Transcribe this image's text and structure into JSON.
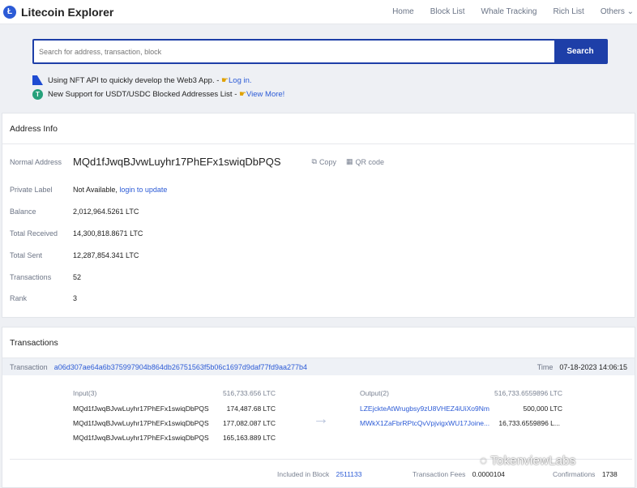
{
  "header": {
    "brand": "Litecoin Explorer",
    "logo_glyph": "Ł",
    "nav": [
      "Home",
      "Block List",
      "Whale Tracking",
      "Rich List",
      "Others ⌄"
    ]
  },
  "search": {
    "placeholder": "Search for address, transaction, block",
    "button": "Search"
  },
  "notices": [
    {
      "text": "Using NFT API to quickly develop the Web3 App. - ",
      "link": "Log in."
    },
    {
      "text": "New Support for USDT/USDC Blocked Addresses List - ",
      "link": "View More!"
    }
  ],
  "address_info": {
    "title": "Address Info",
    "normal_address_label": "Normal Address",
    "address": "MQd1fJwqBJvwLuyhr17PhEFx1swiqDbPQS",
    "copy_label": "Copy",
    "qr_label": "QR code",
    "private_label_label": "Private Label",
    "private_label_value": "Not Available, ",
    "private_label_link": "login to update",
    "balance_label": "Balance",
    "balance": "2,012,964.5261 LTC",
    "total_received_label": "Total Received",
    "total_received": "14,300,818.8671 LTC",
    "total_sent_label": "Total Sent",
    "total_sent": "12,287,854.341 LTC",
    "transactions_label": "Transactions",
    "transactions": "52",
    "rank_label": "Rank",
    "rank": "3"
  },
  "transactions": {
    "title": "Transactions",
    "tx_label": "Transaction",
    "tx_hash": "a06d307ae64a6b375997904b864db26751563f5b06c1697d9daf77fd9aa277b4",
    "time_label": "Time",
    "time": "07-18-2023 14:06:15",
    "input_label": "Input(3)",
    "input_total": "516,733.656 LTC",
    "inputs": [
      {
        "address": "MQd1fJwqBJvwLuyhr17PhEFx1swiqDbPQS",
        "amount": "174,487.68 LTC"
      },
      {
        "address": "MQd1fJwqBJvwLuyhr17PhEFx1swiqDbPQS",
        "amount": "177,082.087 LTC"
      },
      {
        "address": "MQd1fJwqBJvwLuyhr17PhEFx1swiqDbPQS",
        "amount": "165,163.889 LTC"
      }
    ],
    "output_label": "Output(2)",
    "output_total": "516,733.6559896 LTC",
    "outputs": [
      {
        "address": "LZEjckteAtWrugbsy9zU8VHEZ4iUiXo9Nm",
        "amount": "500,000 LTC"
      },
      {
        "address": "MWkX1ZaFbrRPtcQvVpjvigxWU17Joine...",
        "amount": "16,733.6559896 L..."
      }
    ],
    "included_block_label": "Included in Block",
    "included_block": "2511133",
    "fees_label": "Transaction Fees",
    "fees": "0.0000104",
    "confirmations_label": "Confirmations",
    "confirmations": "1738"
  },
  "watermark": "TokenviewLabs",
  "colors": {
    "accent": "#1e3fa8",
    "link": "#2c5bd6"
  }
}
